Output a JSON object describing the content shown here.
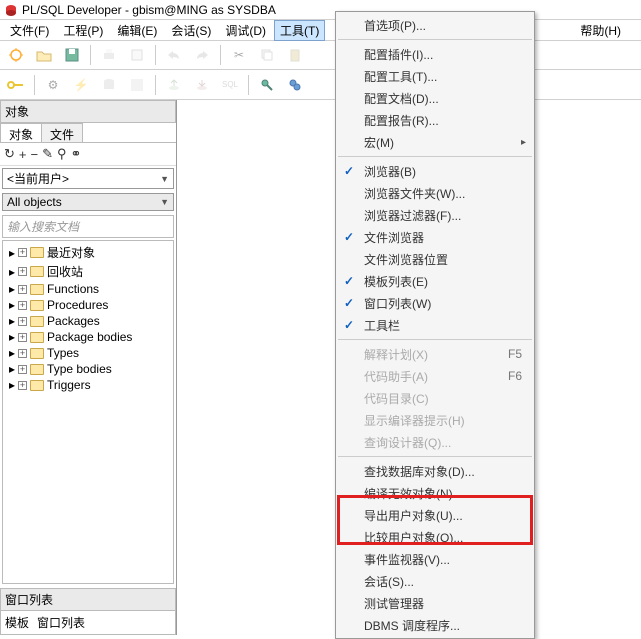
{
  "window": {
    "title": "PL/SQL Developer - gbism@MING as SYSDBA"
  },
  "menubar": {
    "file": "文件(F)",
    "project": "工程(P)",
    "edit": "编辑(E)",
    "session": "会话(S)",
    "debug": "调试(D)",
    "tools": "工具(T)",
    "help": "帮助(H)"
  },
  "sidebar": {
    "objects_title": "对象",
    "tabs": {
      "objects": "对象",
      "files": "文件"
    },
    "ops": {
      "refresh": "↻",
      "plus": "+",
      "minus": "−",
      "wand": "✎",
      "query": "⚲",
      "link": "⚭"
    },
    "user_dd": "<当前用户>",
    "filter_dd": "All objects",
    "search_ph": "输入搜索文档",
    "tree": [
      "最近对象",
      "回收站",
      "Functions",
      "Procedures",
      "Packages",
      "Package bodies",
      "Types",
      "Type bodies",
      "Triggers"
    ],
    "winlist_title": "窗口列表",
    "winlist_tabs": {
      "template": "模板",
      "winlist": "窗口列表"
    }
  },
  "menu": {
    "items": [
      {
        "label": "首选项(P)...",
        "type": "item"
      },
      {
        "type": "sep"
      },
      {
        "label": "配置插件(I)...",
        "type": "item"
      },
      {
        "label": "配置工具(T)...",
        "type": "item"
      },
      {
        "label": "配置文档(D)...",
        "type": "item"
      },
      {
        "label": "配置报告(R)...",
        "type": "item"
      },
      {
        "label": "宏(M)",
        "type": "sub"
      },
      {
        "type": "sep"
      },
      {
        "label": "浏览器(B)",
        "type": "item",
        "checked": true
      },
      {
        "label": "浏览器文件夹(W)...",
        "type": "item"
      },
      {
        "label": "浏览器过滤器(F)...",
        "type": "item"
      },
      {
        "label": "文件浏览器",
        "type": "item",
        "checked": true
      },
      {
        "label": "文件浏览器位置",
        "type": "item"
      },
      {
        "label": "模板列表(E)",
        "type": "item",
        "checked": true
      },
      {
        "label": "窗口列表(W)",
        "type": "item",
        "checked": true
      },
      {
        "label": "工具栏",
        "type": "item",
        "checked": true
      },
      {
        "type": "sep"
      },
      {
        "label": "解释计划(X)",
        "type": "item",
        "disabled": true,
        "shortcut": "F5"
      },
      {
        "label": "代码助手(A)",
        "type": "item",
        "disabled": true,
        "shortcut": "F6"
      },
      {
        "label": "代码目录(C)",
        "type": "item",
        "disabled": true
      },
      {
        "label": "显示编译器提示(H)",
        "type": "item",
        "disabled": true
      },
      {
        "label": "查询设计器(Q)...",
        "type": "item",
        "disabled": true
      },
      {
        "type": "sep"
      },
      {
        "label": "查找数据库对象(D)...",
        "type": "item"
      },
      {
        "label": "编译无效对象(N)...",
        "type": "item"
      },
      {
        "label": "导出用户对象(U)...",
        "type": "item"
      },
      {
        "label": "比较用户对象(O)...",
        "type": "item"
      },
      {
        "label": "事件监视器(V)...",
        "type": "item"
      },
      {
        "label": "会话(S)...",
        "type": "item"
      },
      {
        "label": "测试管理器",
        "type": "item"
      },
      {
        "label": "DBMS 调度程序...",
        "type": "item"
      }
    ]
  }
}
